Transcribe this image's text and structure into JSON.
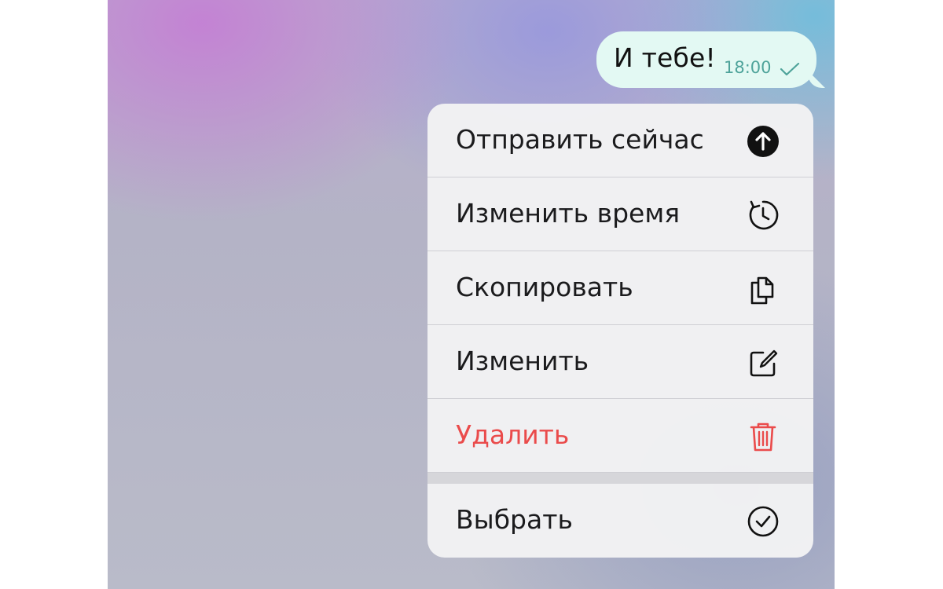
{
  "message": {
    "text": "И тебе!",
    "time": "18:00",
    "status_icon": "check-icon"
  },
  "context_menu": {
    "items": [
      {
        "label": "Отправить сейчас",
        "icon": "send-now-arrow-up-icon",
        "style": "normal"
      },
      {
        "label": "Изменить время",
        "icon": "clock-reschedule-icon",
        "style": "normal"
      },
      {
        "label": "Скопировать",
        "icon": "copy-documents-icon",
        "style": "normal"
      },
      {
        "label": "Изменить",
        "icon": "edit-square-pencil-icon",
        "style": "normal"
      },
      {
        "label": "Удалить",
        "icon": "trash-icon",
        "style": "danger"
      },
      {
        "label": "Выбрать",
        "icon": "check-circle-icon",
        "style": "normal"
      }
    ]
  },
  "colors": {
    "bubble": "#e3f9f3",
    "time_text": "#4ea39a",
    "danger": "#ea4b4b",
    "menu_bg": "#f2f2f4",
    "text": "#1b1b1d"
  }
}
